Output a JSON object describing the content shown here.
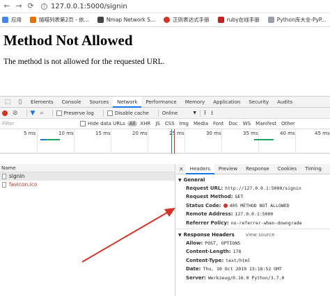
{
  "browser": {
    "url": "127.0.0.1:5000/signin",
    "bookmarks": [
      {
        "label": "应用",
        "color": "#4285f4"
      },
      {
        "label": "随喵列表第2页 - 依...",
        "color": "#e8710a"
      },
      {
        "label": "Nmap Network S...",
        "color": "#444444"
      },
      {
        "label": "正则表达式手册",
        "color": "#d93025"
      },
      {
        "label": "ruby在线手册",
        "color": "#c5221f"
      },
      {
        "label": "Python库大全-PyP...",
        "color": "#9aa0a6"
      }
    ]
  },
  "page": {
    "title": "Method Not Allowed",
    "message": "The method is not allowed for the requested URL."
  },
  "devtools": {
    "tabs": [
      "Elements",
      "Console",
      "Sources",
      "Network",
      "Performance",
      "Memory",
      "Application",
      "Security",
      "Audits"
    ],
    "active_tab": "Network",
    "toolbar": {
      "preserve_log": "Preserve log",
      "disable_cache": "Disable cache",
      "throttle": "Online"
    },
    "filter": {
      "placeholder": "Filter",
      "hide_data_urls": "Hide data URLs",
      "types": [
        "All",
        "XHR",
        "JS",
        "CSS",
        "Img",
        "Media",
        "Font",
        "Doc",
        "WS",
        "Manifest",
        "Other"
      ]
    },
    "timeline": {
      "ticks": [
        "5 ms",
        "10 ms",
        "15 ms",
        "20 ms",
        "25 ms",
        "30 ms",
        "35 ms",
        "40 ms",
        "45 ms"
      ]
    },
    "requests": {
      "column": "Name",
      "rows": [
        {
          "name": "signin",
          "error": false
        },
        {
          "name": "favicon.ico",
          "error": true
        }
      ]
    },
    "details": {
      "tabs": [
        "Headers",
        "Preview",
        "Response",
        "Cookies",
        "Timing"
      ],
      "active_tab": "Headers",
      "general_title": "General",
      "general": [
        {
          "key": "Request URL:",
          "value": "http://127.0.0.1:5000/signin"
        },
        {
          "key": "Request Method:",
          "value": "GET"
        },
        {
          "key": "Status Code:",
          "value": "405 METHOD NOT ALLOWED"
        },
        {
          "key": "Remote Address:",
          "value": "127.0.0.1:5000"
        },
        {
          "key": "Referrer Policy:",
          "value": "no-referrer-when-downgrade"
        }
      ],
      "response_title": "Response Headers",
      "view_source": "view source",
      "response": [
        {
          "key": "Allow:",
          "value": "POST, OPTIONS"
        },
        {
          "key": "Content-Length:",
          "value": "178"
        },
        {
          "key": "Content-Type:",
          "value": "text/html"
        },
        {
          "key": "Date:",
          "value": "Thu, 10 Oct 2019 13:18:52 GMT"
        },
        {
          "key": "Server:",
          "value": "Werkzeug/0.16.0 Python/3.7.0"
        }
      ]
    }
  }
}
